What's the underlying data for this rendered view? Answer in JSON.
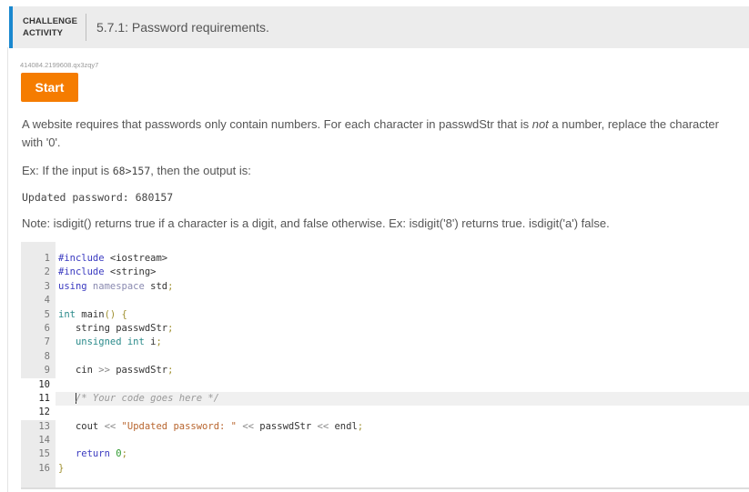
{
  "header": {
    "kind_line1": "CHALLENGE",
    "kind_line2": "ACTIVITY",
    "title": "5.7.1: Password requirements."
  },
  "activity_id": "414084.2199608.qx3zqy7",
  "start_button": "Start",
  "prompt": {
    "p1_a": "A website requires that passwords only contain numbers. For each character in passwdStr that is ",
    "p1_em": "not",
    "p1_b": " a number, replace the character with '0'.",
    "p2_a": "Ex: If the input is ",
    "p2_code": "68>157",
    "p2_b": ", then the output is:",
    "p3": "Updated password: 680157",
    "p4": "Note: isdigit() returns true if a character is a digit, and false otherwise. Ex: isdigit('8') returns true. isdigit('a') false."
  },
  "editor": {
    "line_numbers": [
      "1",
      "2",
      "3",
      "4",
      "5",
      "6",
      "7",
      "8",
      "9",
      "10",
      "11",
      "12",
      "13",
      "14",
      "15",
      "16"
    ],
    "active_line": 11,
    "tokens": {
      "l1_kw": "#include",
      "l1_rest": " <iostream>",
      "l2_kw": "#include",
      "l2_rest": " <string>",
      "l3_kw": "using",
      "l3_ns": " namespace",
      "l3_rest": " std",
      "l3_semi": ";",
      "l5_ty": "int",
      "l5_rest": " main",
      "l5_paren": "()",
      "l5_brace": " {",
      "l6_rest": "   string passwdStr",
      "l6_semi": ";",
      "l7_ty": "   unsigned int",
      "l7_rest": " i",
      "l7_semi": ";",
      "l9_a": "   cin",
      "l9_op": " >>",
      "l9_b": " passwdStr",
      "l9_semi": ";",
      "l11_cm": "/* Your code goes here */",
      "l13_a": "   cout",
      "l13_op1": " <<",
      "l13_str": " \"Updated password: \"",
      "l13_op2": " <<",
      "l13_b": " passwdStr",
      "l13_op3": " <<",
      "l13_c": " endl",
      "l13_semi": ";",
      "l15_kw": "   return",
      "l15_num": " 0",
      "l15_semi": ";",
      "l16_brace": "}"
    }
  }
}
